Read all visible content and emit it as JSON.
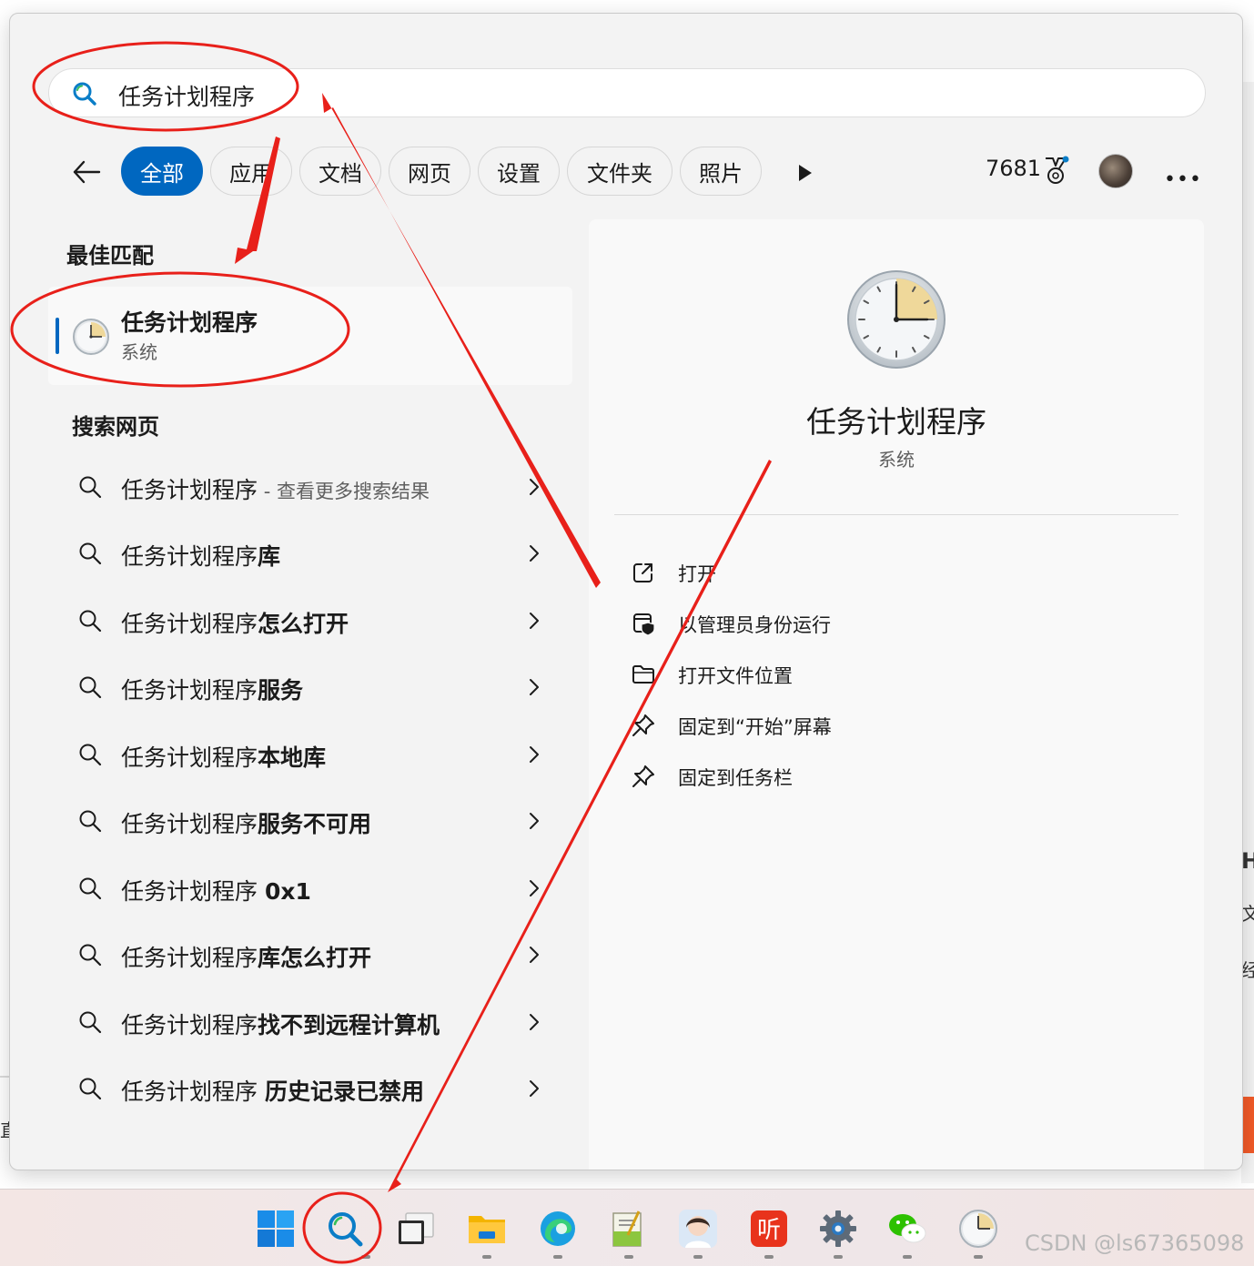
{
  "search": {
    "query": "任务计划程序"
  },
  "filters": {
    "back_label": "",
    "chips": [
      {
        "label": "全部",
        "active": true
      },
      {
        "label": "应用"
      },
      {
        "label": "文档"
      },
      {
        "label": "网页"
      },
      {
        "label": "设置"
      },
      {
        "label": "文件夹"
      },
      {
        "label": "照片"
      }
    ],
    "points": "7681"
  },
  "best_match": {
    "heading": "最佳匹配",
    "name": "任务计划程序",
    "type": "系统"
  },
  "web": {
    "heading": "搜索网页",
    "results": [
      {
        "prefix": "任务计划程序",
        "bold": "",
        "suffix": " - 查看更多搜索结果"
      },
      {
        "prefix": "任务计划程序",
        "bold": "库",
        "suffix": ""
      },
      {
        "prefix": "任务计划程序",
        "bold": "怎么打开",
        "suffix": ""
      },
      {
        "prefix": "任务计划程序",
        "bold": "服务",
        "suffix": ""
      },
      {
        "prefix": "任务计划程序",
        "bold": "本地库",
        "suffix": ""
      },
      {
        "prefix": "任务计划程序",
        "bold": "服务不可用",
        "suffix": ""
      },
      {
        "prefix": "任务计划程序 ",
        "bold": "0x1",
        "suffix": ""
      },
      {
        "prefix": "任务计划程序",
        "bold": "库怎么打开",
        "suffix": ""
      },
      {
        "prefix": "任务计划程序",
        "bold": "找不到远程计算机",
        "suffix": ""
      },
      {
        "prefix": "任务计划程序 ",
        "bold": "历史记录已禁用",
        "suffix": ""
      }
    ]
  },
  "detail": {
    "name": "任务计划程序",
    "type": "系统",
    "actions": [
      {
        "label": "打开",
        "icon": "open-external-icon"
      },
      {
        "label": "以管理员身份运行",
        "icon": "run-as-admin-icon"
      },
      {
        "label": "打开文件位置",
        "icon": "folder-icon"
      },
      {
        "label": "固定到“开始”屏幕",
        "icon": "pin-icon"
      },
      {
        "label": "固定到任务栏",
        "icon": "pin-icon"
      }
    ]
  },
  "taskbar": {
    "apps": [
      "start",
      "search",
      "task-view",
      "file-explorer",
      "edge",
      "notepad",
      "avatar-app",
      "listen-app",
      "settings",
      "wechat",
      "task-scheduler"
    ]
  },
  "background": {
    "peek_texts": [
      "Hi",
      "文",
      "经",
      "直"
    ]
  },
  "watermark": "CSDN @ls67365098",
  "colors": {
    "accent": "#0067c0",
    "annotation": "#e8201a"
  }
}
